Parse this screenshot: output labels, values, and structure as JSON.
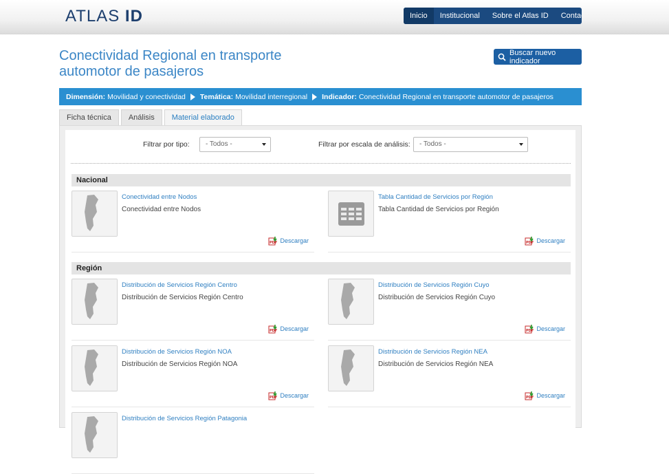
{
  "header": {
    "logo_light": "ATLAS",
    "logo_bold": "ID",
    "nav": [
      "Inicio",
      "Institucional",
      "Sobre el Atlas ID",
      "Contacto"
    ]
  },
  "page": {
    "title": "Conectividad Regional en transporte automotor de pasajeros",
    "search_button": "Buscar nuevo indicador"
  },
  "breadcrumb": {
    "dim_label": "Dimensión:",
    "dim_value": "Movilidad y conectividad",
    "tem_label": "Temática:",
    "tem_value": "Movilidad interregional",
    "ind_label": "Indicador:",
    "ind_value": "Conectividad Regional en transporte automotor de pasajeros"
  },
  "tabs": [
    "Ficha técnica",
    "Análisis",
    "Material elaborado"
  ],
  "filters": {
    "type_label": "Filtrar por tipo:",
    "type_value": "- Todos -",
    "scale_label": "Filtrar por escala de análisis:",
    "scale_value": "- Todos -"
  },
  "download_label": "Descargar",
  "sections": [
    {
      "title": "Nacional",
      "items": [
        {
          "link": "Conectividad entre Nodos",
          "desc": "Conectividad entre Nodos",
          "icon": "map-thumbnail-icon"
        },
        {
          "link": "Tabla Cantidad de Servicios por Región",
          "desc": "Tabla Cantidad de Servicios por Región",
          "icon": "table-thumbnail-icon"
        }
      ]
    },
    {
      "title": "Región",
      "items": [
        {
          "link": "Distribución de Servicios Región Centro",
          "desc": "Distribución de Servicios Región Centro",
          "icon": "map-thumbnail-icon"
        },
        {
          "link": "Distribución de Servicios Región Cuyo",
          "desc": "Distribución de Servicios Región Cuyo",
          "icon": "map-thumbnail-icon"
        },
        {
          "link": "Distribución de Servicios Región NOA",
          "desc": "Distribución de Servicios Región NOA",
          "icon": "map-thumbnail-icon"
        },
        {
          "link": "Distribución de Servicios Región NEA",
          "desc": "Distribución de Servicios Región NEA",
          "icon": "map-thumbnail-icon"
        },
        {
          "link": "Distribución de Servicios Región Patagonia",
          "desc": "",
          "icon": "map-thumbnail-icon"
        }
      ]
    }
  ],
  "colors": {
    "nav_bg": "#1b4a80",
    "title": "#3b86c6",
    "breadcrumb_bg": "#2a8fd1",
    "link": "#2f7fc1"
  }
}
